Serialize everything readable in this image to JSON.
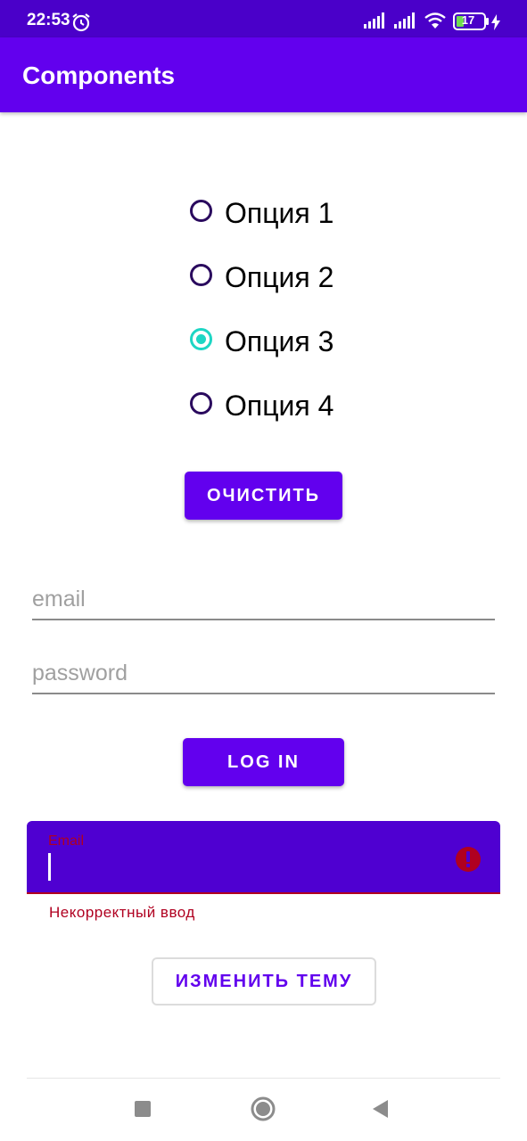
{
  "status_bar": {
    "time": "22:53",
    "battery_level": "17",
    "icons": [
      "alarm-icon",
      "signal-icon",
      "signal-icon",
      "wifi-icon",
      "battery-icon",
      "charging-icon"
    ]
  },
  "app_bar": {
    "title": "Components"
  },
  "radio_group": {
    "options": [
      "Опция 1",
      "Опция 2",
      "Опция 3",
      "Опция 4"
    ],
    "selected_index": 2
  },
  "clear_button": {
    "label": "ОЧИСТИТЬ"
  },
  "login_form": {
    "email_placeholder": "email",
    "password_placeholder": "password",
    "login_label": "LOG IN"
  },
  "email_error_field": {
    "label": "Email",
    "value": "",
    "helper_text": "Некорректный ввод",
    "icon": "error-icon"
  },
  "change_theme_button": {
    "label": "ИЗМЕНИТЬ ТЕМУ"
  },
  "nav_bar": {
    "buttons": [
      "recents-icon",
      "home-icon",
      "back-icon"
    ]
  },
  "colors": {
    "status_bar": "#4a00c9",
    "primary": "#6200ee",
    "filled_field_bg": "#4f00d1",
    "radio_checked": "#1dd6c4",
    "radio_unchecked": "#2a0a5e",
    "error": "#b00020"
  }
}
